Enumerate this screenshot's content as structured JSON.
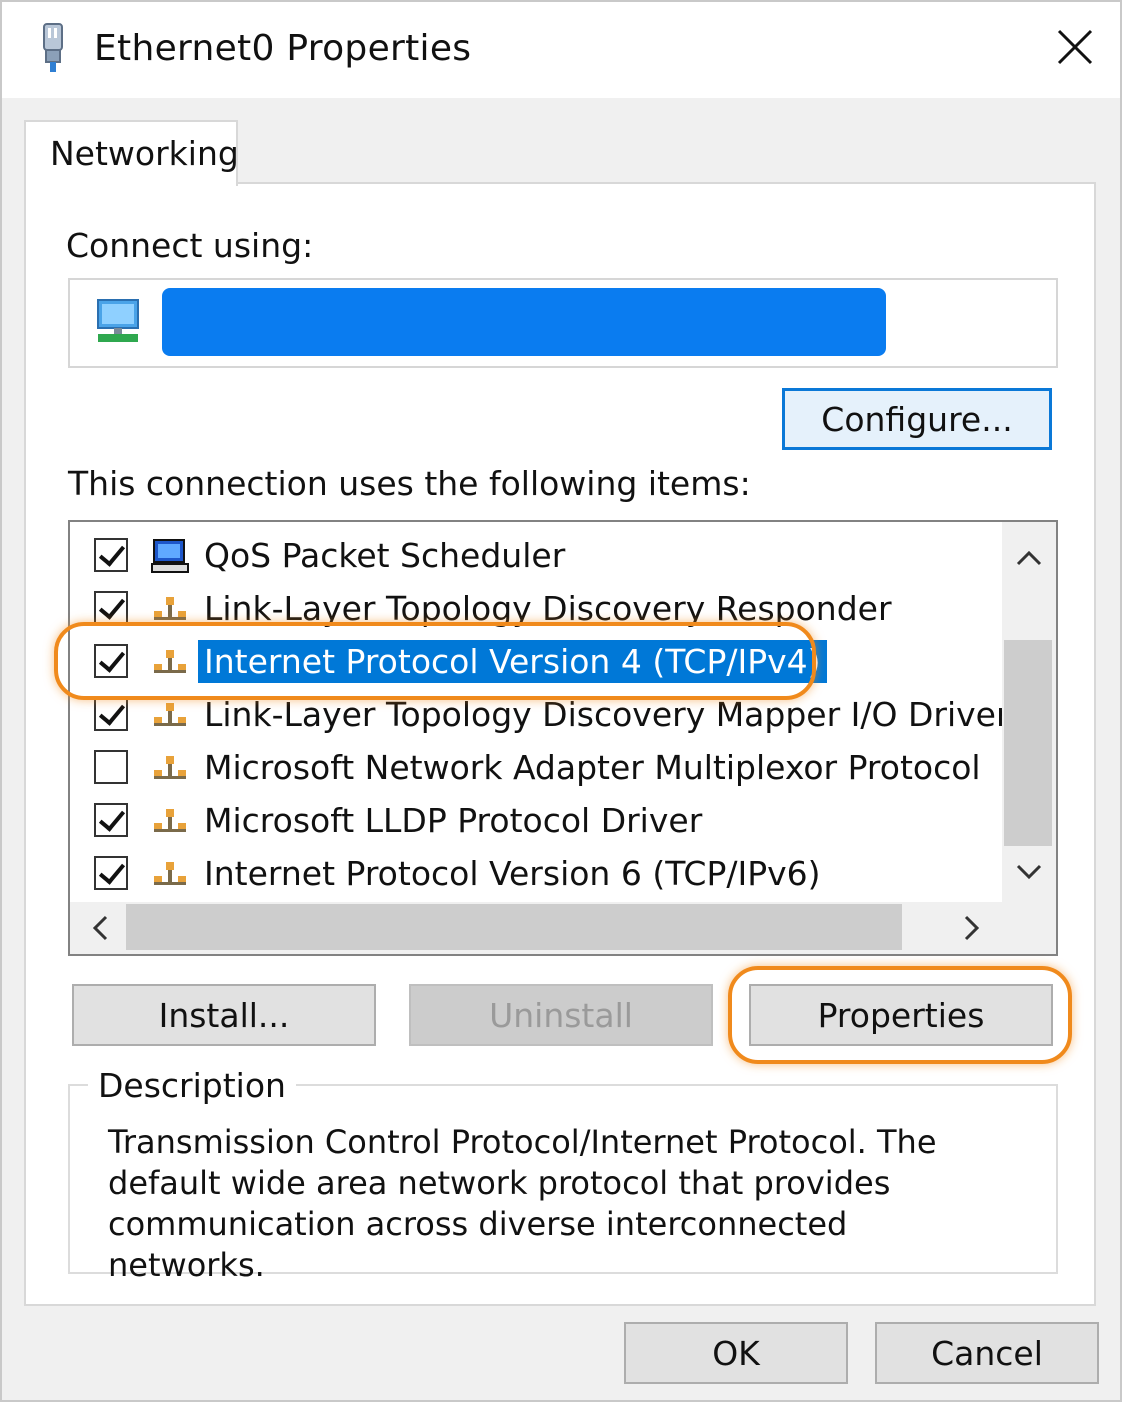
{
  "window": {
    "title": "Ethernet0 Properties",
    "close_label": "Close"
  },
  "tabs": [
    {
      "label": "Networking"
    }
  ],
  "connect_using": {
    "label": "Connect using:"
  },
  "configure_button": "Configure...",
  "items_label": "This connection uses the following items:",
  "items": [
    {
      "label": "QoS Packet Scheduler",
      "checked": true,
      "icon": "computer-icon"
    },
    {
      "label": "Link-Layer Topology Discovery Responder",
      "checked": true,
      "icon": "network-protocol-icon"
    },
    {
      "label": "Internet Protocol Version 4 (TCP/IPv4)",
      "checked": true,
      "icon": "network-protocol-icon",
      "selected": true
    },
    {
      "label": "Link-Layer Topology Discovery Mapper I/O Driver",
      "checked": true,
      "icon": "network-protocol-icon"
    },
    {
      "label": "Microsoft Network Adapter Multiplexor Protocol",
      "checked": false,
      "icon": "network-protocol-icon"
    },
    {
      "label": "Microsoft LLDP Protocol Driver",
      "checked": true,
      "icon": "network-protocol-icon"
    },
    {
      "label": "Internet Protocol Version 6 (TCP/IPv6)",
      "checked": true,
      "icon": "network-protocol-icon"
    }
  ],
  "buttons": {
    "install": "Install...",
    "uninstall": "Uninstall",
    "properties": "Properties"
  },
  "description": {
    "legend": "Description",
    "text": "Transmission Control Protocol/Internet Protocol. The default wide area network protocol that provides communication across diverse interconnected networks."
  },
  "footer": {
    "ok": "OK",
    "cancel": "Cancel"
  },
  "colors": {
    "selection": "#0078d7",
    "focus_border": "#0a78d7",
    "highlight": "#f08a1c",
    "redaction": "#0a7cf0"
  }
}
